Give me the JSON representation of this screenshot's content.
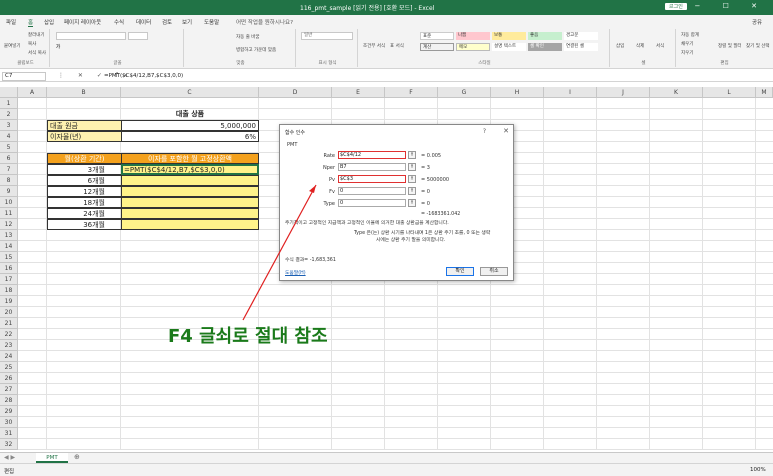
{
  "window": {
    "title": "116_pmt_sample [읽기 전용] [호환 모드] - Excel",
    "login_label": "로그인",
    "buttons": "▭ − ☐ ✕"
  },
  "menu": {
    "items": [
      "파일",
      "홈",
      "삽입",
      "페이지 레이아웃",
      "수식",
      "데이터",
      "검토",
      "보기",
      "도움말",
      "어떤 작업을 원하시나요?"
    ],
    "share": "공유"
  },
  "ribbon": {
    "clipboard_label": "클립보드",
    "paste": "붙여넣기",
    "cut": "잘라내기",
    "copy": "복사",
    "format_painter": "서식 복사",
    "font_label": "글꼴",
    "font_bold": "가",
    "align_label": "맞춤",
    "wrap": "자동 줄 바꿈",
    "merge": "병합하고 가운데 맞춤",
    "number_label": "표시 형식",
    "number_format": "일반",
    "cond_format": "조건부 서식",
    "table_format": "표 서식",
    "styles_label": "스타일",
    "styles": [
      {
        "name": "표준",
        "color": "#ffffff"
      },
      {
        "name": "나쁨",
        "color": "#ffc7ce"
      },
      {
        "name": "보통",
        "color": "#ffeb9c"
      },
      {
        "name": "좋음",
        "color": "#c6efce"
      },
      {
        "name": "경고문",
        "color": "#ffffff"
      },
      {
        "name": "계산",
        "color": "#f2f2f2"
      },
      {
        "name": "메모",
        "color": "#ffffcc"
      },
      {
        "name": "설명 텍스트",
        "color": "#ffffff"
      },
      {
        "name": "셀 확인",
        "color": "#a5a5a5"
      },
      {
        "name": "연결된 셀",
        "color": "#ffffff"
      }
    ],
    "cells_label": "셀",
    "insert": "삽입",
    "delete": "삭제",
    "format": "서식",
    "edit_label": "편집",
    "autosum": "자동 합계",
    "fill": "채우기",
    "clear": "지우기",
    "sort": "정렬 및 필터",
    "find": "찾기 및 선택"
  },
  "formula_bar": {
    "name_box": "C7",
    "buttons": "⋮ ✕ ✓ fx",
    "formula": "=PMT($C$4/12,B7,$C$3,0,0)"
  },
  "columns": [
    "A",
    "B",
    "C",
    "D",
    "E",
    "F",
    "G",
    "H",
    "I",
    "J",
    "K",
    "L",
    "M"
  ],
  "rows": [
    "1",
    "2",
    "3",
    "4",
    "5",
    "6",
    "7",
    "8",
    "9",
    "10",
    "11",
    "12",
    "13",
    "14",
    "15",
    "16",
    "17",
    "18",
    "19",
    "20",
    "21",
    "22",
    "23",
    "24",
    "25",
    "26",
    "27",
    "28",
    "29",
    "30",
    "31",
    "32"
  ],
  "sheet": {
    "title": "대출 상품",
    "loan_label": "대출 원금",
    "loan_value": "5,000,000",
    "rate_label": "이자율(년)",
    "rate_value": "6%",
    "hdr_period": "월(상환 기간)",
    "hdr_payment": "이자를 포함한 월 고정상환액",
    "periods": [
      "3개월",
      "6개월",
      "12개월",
      "18개월",
      "24개월",
      "36개월"
    ],
    "edit_formula": "=PMT($C$4/12,B7,$C$3,0,0)",
    "header_color": "#f4a11d",
    "label_color": "#fff2b0",
    "payment_color": "#fff38a"
  },
  "dialog": {
    "title": "함수 인수",
    "help": "?",
    "close": "✕",
    "function_name": "PMT",
    "args": [
      {
        "label": "Rate",
        "value": "$C$4/12",
        "result": "0.005"
      },
      {
        "label": "Nper",
        "value": "B7",
        "result": "3"
      },
      {
        "label": "Pv",
        "value": "$C$3",
        "result": "5000000"
      },
      {
        "label": "Fv",
        "value": "0",
        "result": "0"
      },
      {
        "label": "Type",
        "value": "0",
        "result": "0"
      }
    ],
    "eq": "=",
    "total": "= -1683361.042",
    "description": "주기적이고 고정적인 지급액과 고정적인 이율에 의거한 대출 상환금을 계산합니다.",
    "type_help_1": "Type  은(는) 상환 시기를 나타내며 1은 상환 주기 초를, 0 또는 생략",
    "type_help_2": "시에는 상환 주기 말을 의미합니다.",
    "result_label": "수식 결과=  -1,683,361",
    "help_link": "도움말(H)",
    "ok": "확인",
    "cancel": "취소"
  },
  "annotation": "F4 글쇠로 절대 참조",
  "sheet_tab": "PMT",
  "status": {
    "mode": "편집",
    "zoom": "100%"
  }
}
